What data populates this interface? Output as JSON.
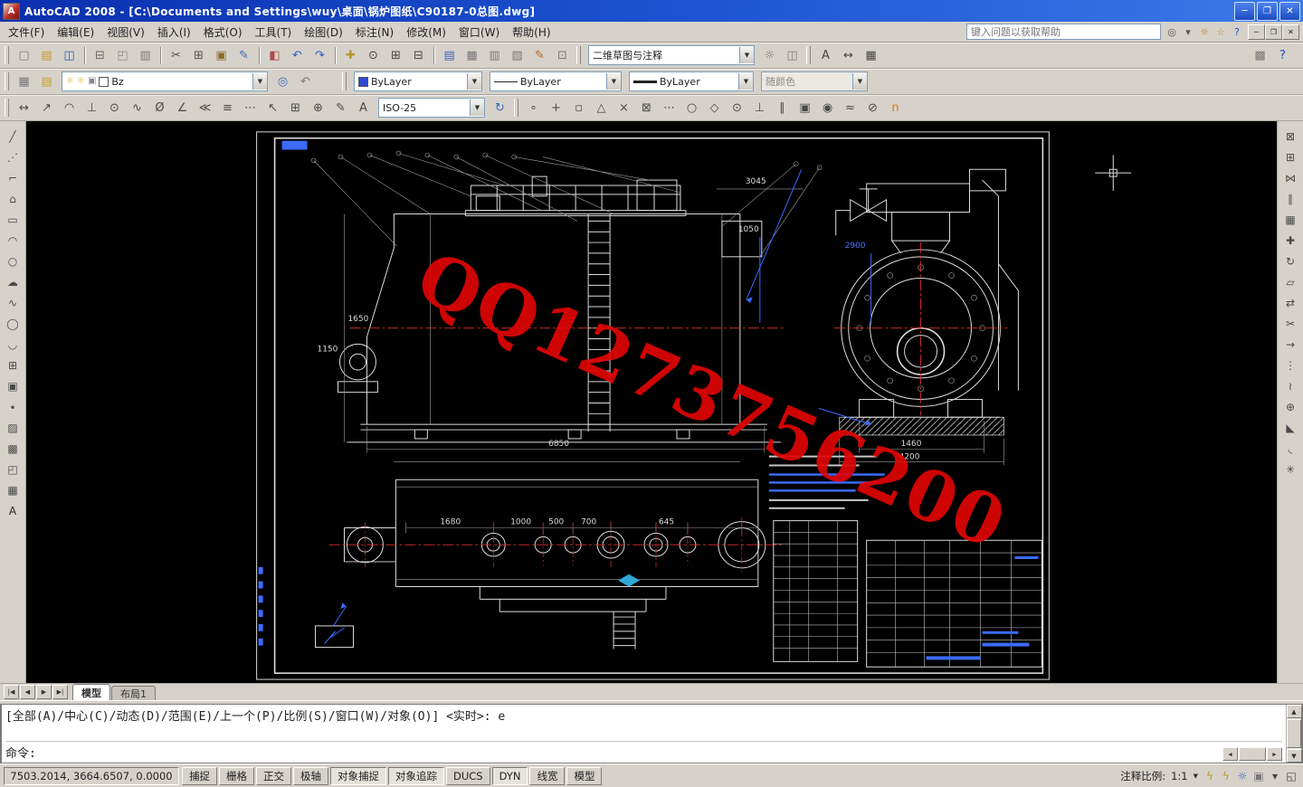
{
  "window": {
    "title": "AutoCAD 2008 - [C:\\Documents and Settings\\wuy\\桌面\\锅炉图纸\\C90187-0总图.dwg]",
    "buttons": [
      {
        "name": "minimize-button",
        "glyph": "─"
      },
      {
        "name": "restore-button",
        "glyph": "❐"
      },
      {
        "name": "close-button",
        "glyph": "✕"
      }
    ]
  },
  "menubar": {
    "items": [
      {
        "label": "文件(F)",
        "name": "menu-file"
      },
      {
        "label": "编辑(E)",
        "name": "menu-edit"
      },
      {
        "label": "视图(V)",
        "name": "menu-view"
      },
      {
        "label": "插入(I)",
        "name": "menu-insert"
      },
      {
        "label": "格式(O)",
        "name": "menu-format"
      },
      {
        "label": "工具(T)",
        "name": "menu-tools"
      },
      {
        "label": "绘图(D)",
        "name": "menu-draw"
      },
      {
        "label": "标注(N)",
        "name": "menu-dimension"
      },
      {
        "label": "修改(M)",
        "name": "menu-modify"
      },
      {
        "label": "窗口(W)",
        "name": "menu-window"
      },
      {
        "label": "帮助(H)",
        "name": "menu-help"
      }
    ],
    "help_placeholder": "键入问题以获取帮助",
    "infocenter_icons": [
      {
        "name": "search-icon",
        "glyph": "◎",
        "color": "#555555"
      },
      {
        "name": "search-dropdown-icon",
        "glyph": "▾",
        "color": "#555555"
      },
      {
        "name": "communication-center-icon",
        "glyph": "☼",
        "color": "#c08020"
      },
      {
        "name": "favorites-icon",
        "glyph": "☆",
        "color": "#c08020"
      },
      {
        "name": "help-icon",
        "glyph": "?",
        "color": "#2050c0"
      }
    ],
    "mdi_buttons": [
      {
        "name": "mdi-minimize-button",
        "glyph": "─"
      },
      {
        "name": "mdi-restore-button",
        "glyph": "❐"
      },
      {
        "name": "mdi-close-button",
        "glyph": "✕"
      }
    ]
  },
  "toolbar1": {
    "standard": [
      {
        "name": "new-button",
        "glyph": "▢",
        "color": "#777777"
      },
      {
        "name": "open-button",
        "glyph": "▤",
        "color": "#c89a30"
      },
      {
        "name": "save-button",
        "glyph": "◫",
        "color": "#3a58b8"
      },
      {
        "name": "separator"
      },
      {
        "name": "plot-button",
        "glyph": "⊟",
        "color": "#666666"
      },
      {
        "name": "plot-preview-button",
        "glyph": "◰",
        "color": "#888888"
      },
      {
        "name": "publish-button",
        "glyph": "▥",
        "color": "#777777"
      },
      {
        "name": "separator"
      },
      {
        "name": "cut-button",
        "glyph": "✂",
        "color": "#555555"
      },
      {
        "name": "copy-button",
        "glyph": "⊞",
        "color": "#555555"
      },
      {
        "name": "paste-button",
        "glyph": "▣",
        "color": "#8a6a30"
      },
      {
        "name": "match-properties-button",
        "glyph": "✎",
        "color": "#3a68b8"
      },
      {
        "name": "separator"
      },
      {
        "name": "block-editor-button",
        "glyph": "◧",
        "color": "#b04848"
      },
      {
        "name": "undo-button",
        "glyph": "↶",
        "color": "#2a58c8"
      },
      {
        "name": "redo-button",
        "glyph": "↷",
        "color": "#2a58c8"
      },
      {
        "name": "separator"
      },
      {
        "name": "pan-button",
        "glyph": "✚",
        "color": "#b89830"
      },
      {
        "name": "zoom-realtime-button",
        "glyph": "⊙",
        "color": "#444444"
      },
      {
        "name": "zoom-window-button",
        "glyph": "⊞",
        "color": "#444444"
      },
      {
        "name": "zoom-previous-button",
        "glyph": "⊟",
        "color": "#444444"
      },
      {
        "name": "separator"
      },
      {
        "name": "properties-button",
        "glyph": "▤",
        "color": "#3a68b8"
      },
      {
        "name": "designcenter-button",
        "glyph": "▦",
        "color": "#777777"
      },
      {
        "name": "tool-palettes-button",
        "glyph": "▥",
        "color": "#777777"
      },
      {
        "name": "sheet-set-manager-button",
        "glyph": "▧",
        "color": "#777777"
      },
      {
        "name": "markup-set-manager-button",
        "glyph": "✎",
        "color": "#b06030"
      },
      {
        "name": "quickcalc-button",
        "glyph": "⊡",
        "color": "#777777"
      }
    ],
    "workspace_combo": {
      "value": "二维草图与注释"
    },
    "workspace_icons": [
      {
        "name": "workspace-settings-button",
        "glyph": "☼",
        "color": "#777777"
      },
      {
        "name": "save-workspace-button",
        "glyph": "◫",
        "color": "#777777"
      }
    ],
    "styles_icons": [
      {
        "name": "text-style-button",
        "glyph": "A",
        "color": "#444444"
      },
      {
        "name": "dimension-style-button",
        "glyph": "↔",
        "color": "#444444"
      },
      {
        "name": "table-style-button",
        "glyph": "▦",
        "color": "#444444"
      }
    ],
    "right_icons": [
      {
        "name": "render-button",
        "glyph": "▩",
        "color": "#777777"
      },
      {
        "name": "help-button",
        "glyph": "?",
        "color": "#2050c0"
      }
    ]
  },
  "toolbar2": {
    "left_icons": [
      {
        "name": "layer-properties-button",
        "glyph": "▦",
        "color": "#777777"
      },
      {
        "name": "layer-states-button",
        "glyph": "▤",
        "color": "#c8a030"
      }
    ],
    "layer_combo": {
      "value": "Bz"
    },
    "after_icons": [
      {
        "name": "make-object-layer-current-button",
        "glyph": "◎",
        "color": "#3a68b8"
      },
      {
        "name": "layer-previous-button",
        "glyph": "↶",
        "color": "#777777"
      }
    ],
    "color_combo": {
      "value": "ByLayer",
      "swatch": "#2f48d0"
    },
    "linetype_combo": {
      "value": "ByLayer"
    },
    "lineweight_combo": {
      "value": "ByLayer"
    },
    "plotstyle_combo": {
      "value": "随颜色"
    }
  },
  "toolbar3": {
    "dim_icons": [
      {
        "name": "linear-dimension-button",
        "glyph": "↔"
      },
      {
        "name": "aligned-dimension-button",
        "glyph": "↗"
      },
      {
        "name": "arc-length-dimension-button",
        "glyph": "◠"
      },
      {
        "name": "ordinate-dimension-button",
        "glyph": "⊥"
      },
      {
        "name": "radius-dimension-button",
        "glyph": "⊙"
      },
      {
        "name": "jogged-dimension-button",
        "glyph": "∿"
      },
      {
        "name": "diameter-dimension-button",
        "glyph": "Ø"
      },
      {
        "name": "angular-dimension-button",
        "glyph": "∠"
      },
      {
        "name": "quick-dimension-button",
        "glyph": "≪"
      },
      {
        "name": "baseline-dimension-button",
        "glyph": "≡"
      },
      {
        "name": "continue-dimension-button",
        "glyph": "⋯"
      },
      {
        "name": "quick-leader-button",
        "glyph": "↖"
      },
      {
        "name": "tolerance-button",
        "glyph": "⊞"
      },
      {
        "name": "center-mark-button",
        "glyph": "⊕"
      },
      {
        "name": "dimension-edit-button",
        "glyph": "✎"
      },
      {
        "name": "dimension-text-edit-button",
        "glyph": "A"
      }
    ],
    "dimstyle_combo": {
      "value": "ISO-25"
    },
    "after_icons": [
      {
        "name": "dimension-update-button",
        "glyph": "↻",
        "color": "#3a68b8"
      }
    ],
    "osnap_icons": [
      {
        "name": "temporary-track-point-button",
        "glyph": "∘"
      },
      {
        "name": "snap-from-button",
        "glyph": "+"
      },
      {
        "name": "snap-endpoint-button",
        "glyph": "▫"
      },
      {
        "name": "snap-midpoint-button",
        "glyph": "△"
      },
      {
        "name": "snap-intersection-button",
        "glyph": "×"
      },
      {
        "name": "snap-apparent-intersection-button",
        "glyph": "⊠"
      },
      {
        "name": "snap-extension-button",
        "glyph": "⋯"
      },
      {
        "name": "snap-center-button",
        "glyph": "○"
      },
      {
        "name": "snap-quadrant-button",
        "glyph": "◇"
      },
      {
        "name": "snap-tangent-button",
        "glyph": "⊙"
      },
      {
        "name": "snap-perpendicular-button",
        "glyph": "⊥"
      },
      {
        "name": "snap-parallel-button",
        "glyph": "∥"
      },
      {
        "name": "snap-insert-button",
        "glyph": "▣"
      },
      {
        "name": "snap-node-button",
        "glyph": "◉"
      },
      {
        "name": "snap-nearest-button",
        "glyph": "≈"
      },
      {
        "name": "snap-none-button",
        "glyph": "⊘"
      },
      {
        "name": "osnap-settings-button",
        "glyph": "n",
        "color": "#e07818"
      }
    ]
  },
  "draw_toolbar": [
    {
      "name": "line-tool",
      "glyph": "╱"
    },
    {
      "name": "construction-line-tool",
      "glyph": "⋰"
    },
    {
      "name": "polyline-tool",
      "glyph": "⌐"
    },
    {
      "name": "polygon-tool",
      "glyph": "⌂"
    },
    {
      "name": "rectangle-tool",
      "glyph": "▭"
    },
    {
      "name": "arc-tool",
      "glyph": "◠"
    },
    {
      "name": "circle-tool",
      "glyph": "○"
    },
    {
      "name": "revision-cloud-tool",
      "glyph": "☁"
    },
    {
      "name": "spline-tool",
      "glyph": "∿"
    },
    {
      "name": "ellipse-tool",
      "glyph": "◯"
    },
    {
      "name": "ellipse-arc-tool",
      "glyph": "◡"
    },
    {
      "name": "insert-block-tool",
      "glyph": "⊞"
    },
    {
      "name": "make-block-tool",
      "glyph": "▣"
    },
    {
      "name": "point-tool",
      "glyph": "∙"
    },
    {
      "name": "hatch-tool",
      "glyph": "▨"
    },
    {
      "name": "gradient-tool",
      "glyph": "▩"
    },
    {
      "name": "region-tool",
      "glyph": "◰"
    },
    {
      "name": "table-tool",
      "glyph": "▦"
    },
    {
      "name": "multiline-text-tool",
      "glyph": "A",
      "color": "#222222"
    }
  ],
  "modify_toolbar": [
    {
      "name": "erase-tool",
      "glyph": "⊠"
    },
    {
      "name": "copy-tool",
      "glyph": "⊞"
    },
    {
      "name": "mirror-tool",
      "glyph": "⋈"
    },
    {
      "name": "offset-tool",
      "glyph": "∥"
    },
    {
      "name": "array-tool",
      "glyph": "▦"
    },
    {
      "name": "move-tool",
      "glyph": "✚"
    },
    {
      "name": "rotate-tool",
      "glyph": "↻"
    },
    {
      "name": "scale-tool",
      "glyph": "▱"
    },
    {
      "name": "stretch-tool",
      "glyph": "⇄"
    },
    {
      "name": "trim-tool",
      "glyph": "✂"
    },
    {
      "name": "extend-tool",
      "glyph": "→"
    },
    {
      "name": "break-at-point-tool",
      "glyph": "⋮"
    },
    {
      "name": "break-tool",
      "glyph": "≀"
    },
    {
      "name": "join-tool",
      "glyph": "⊕"
    },
    {
      "name": "chamfer-tool",
      "glyph": "◣"
    },
    {
      "name": "fillet-tool",
      "glyph": "◟"
    },
    {
      "name": "explode-tool",
      "glyph": "✳"
    }
  ],
  "tabs": {
    "nav": [
      {
        "name": "tab-first-button",
        "glyph": "|◀"
      },
      {
        "name": "tab-prev-button",
        "glyph": "◀"
      },
      {
        "name": "tab-next-button",
        "glyph": "▶"
      },
      {
        "name": "tab-last-button",
        "glyph": "▶|"
      }
    ],
    "items": [
      {
        "label": "模型",
        "name": "tab-model",
        "active": true
      },
      {
        "label": "布局1",
        "name": "tab-layout1",
        "active": false
      }
    ]
  },
  "command": {
    "history": "[全部(A)/中心(C)/动态(D)/范围(E)/上一个(P)/比例(S)/窗口(W)/对象(O)] <实时>: e",
    "prompt": "命令:"
  },
  "statusbar": {
    "coords": "7503.2014, 3664.6507, 0.0000",
    "toggles": [
      {
        "label": "捕捉",
        "name": "snap-toggle",
        "pressed": false
      },
      {
        "label": "栅格",
        "name": "grid-toggle",
        "pressed": false
      },
      {
        "label": "正交",
        "name": "ortho-toggle",
        "pressed": false
      },
      {
        "label": "极轴",
        "name": "polar-toggle",
        "pressed": false
      },
      {
        "label": "对象捕捉",
        "name": "osnap-toggle",
        "pressed": true
      },
      {
        "label": "对象追踪",
        "name": "otrack-toggle",
        "pressed": true
      },
      {
        "label": "DUCS",
        "name": "ducs-toggle",
        "pressed": false
      },
      {
        "label": "DYN",
        "name": "dyn-toggle",
        "pressed": true
      },
      {
        "label": "线宽",
        "name": "lineweight-toggle",
        "pressed": false
      },
      {
        "label": "模型",
        "name": "model-toggle",
        "pressed": false
      }
    ],
    "annotation_scale_label": "注释比例:",
    "annotation_scale_value": "1:1",
    "right_icons": [
      {
        "name": "annotation-visibility-icon",
        "glyph": "ϟ",
        "color": "#b89820"
      },
      {
        "name": "annotation-autoscale-icon",
        "glyph": "ϟ",
        "color": "#b89820"
      },
      {
        "name": "communication-center-tray-icon",
        "glyph": "☼",
        "color": "#3060c0"
      },
      {
        "name": "toolbar-lock-icon",
        "glyph": "▣",
        "color": "#777777"
      },
      {
        "name": "tray-arrow-icon",
        "glyph": "▾",
        "color": "#444444"
      },
      {
        "name": "clean-screen-icon",
        "glyph": "◱",
        "color": "#444444"
      }
    ]
  },
  "drawing": {
    "watermark": "QQ1273756200",
    "labels": {
      "d1650": "1650",
      "d1150": "1150",
      "d6850": "6850",
      "d3045": "3045",
      "d1050": "1050",
      "d2900": "2900",
      "d1460": "1460",
      "d4200": "4200",
      "d1680": "1680",
      "d1000": "1000",
      "d500": "500",
      "d700": "700",
      "d645": "645"
    },
    "colors": {
      "canvas": "#000000",
      "line": "#dcdcdc",
      "annotation": "#3b6bff",
      "centerline": "#e03030",
      "watermark": "#e00505"
    }
  },
  "ui": {
    "combo_arrow": "▼",
    "scroll_up": "▲",
    "scroll_down": "▼",
    "scroll_left": "◀",
    "scroll_right": "▶"
  }
}
